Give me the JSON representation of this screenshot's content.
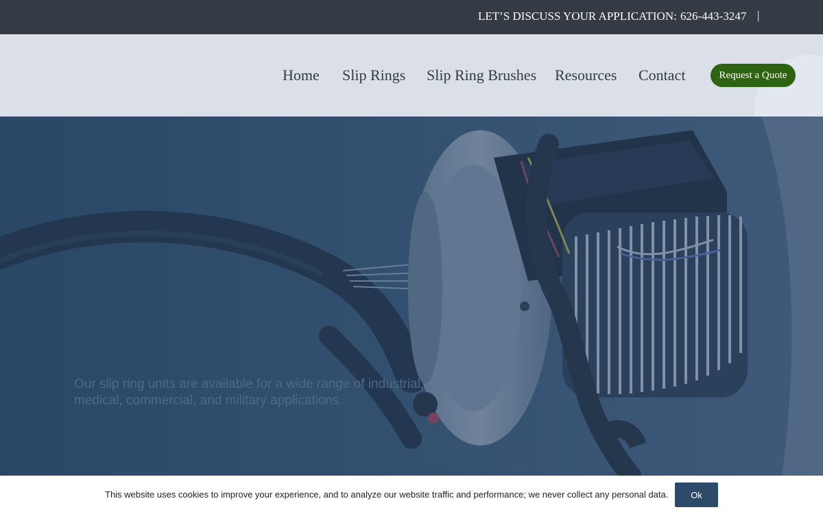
{
  "topbar": {
    "cta_text": "LET’S DISCUSS YOUR APPLICATION:",
    "phone": "626-443-3247",
    "separator": "|"
  },
  "nav": {
    "items": [
      {
        "label": "Home"
      },
      {
        "label": "Slip Rings"
      },
      {
        "label": "Slip Ring Brushes"
      },
      {
        "label": "Resources"
      },
      {
        "label": "Contact"
      }
    ],
    "quote_button": "Request a Quote"
  },
  "hero": {
    "tagline": "Our slip ring units are available for a wide range of industrial, medical, commercial, and military applications."
  },
  "cookie": {
    "message": "This website uses cookies to improve your experience, and to analyze our website traffic and performance; we never collect any personal data.",
    "ok_label": "Ok"
  },
  "colors": {
    "topbar_bg": "#343b44",
    "nav_bg": "#dbe0e8",
    "accent_green": "#2e6411",
    "hero_overlay": "#2c4866",
    "ok_button": "#2e4a6b"
  }
}
